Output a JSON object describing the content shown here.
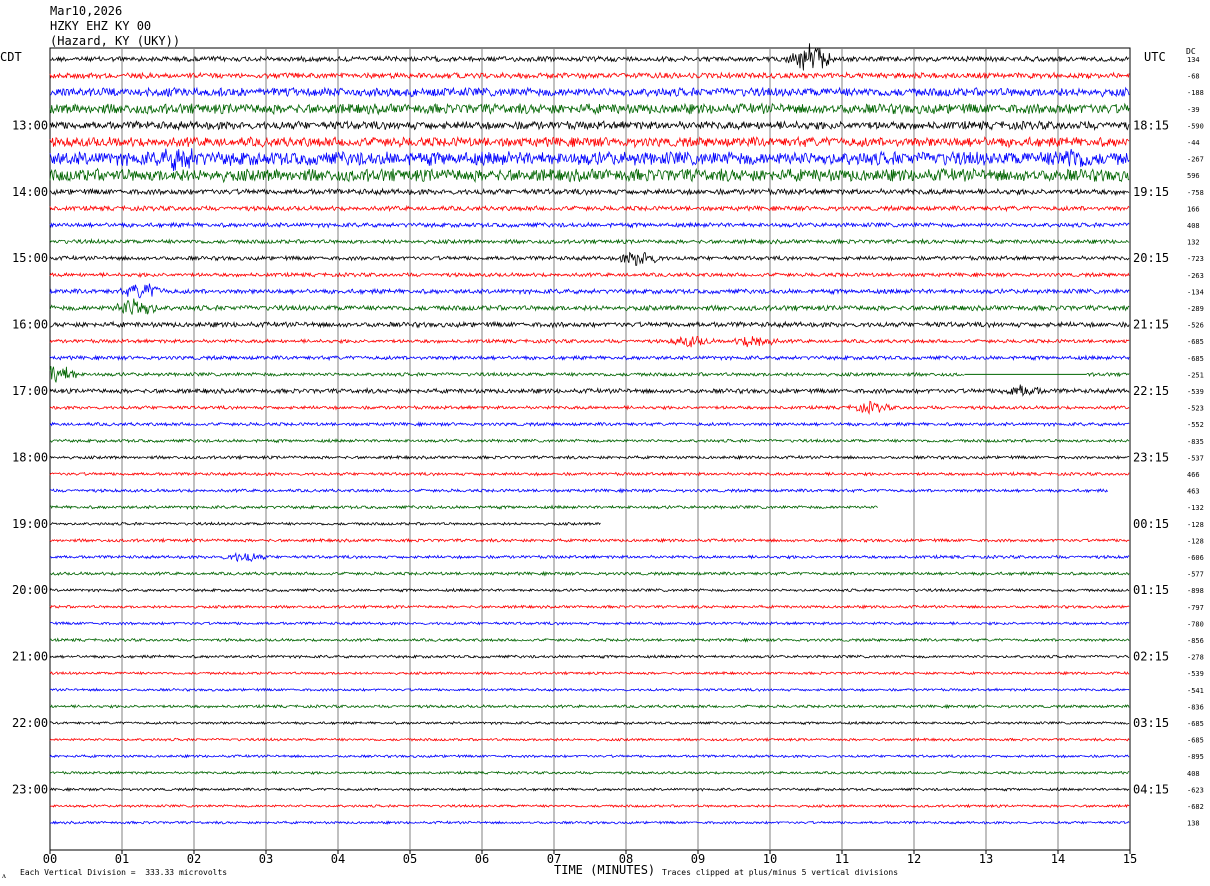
{
  "header": {
    "date": "Mar10,2026",
    "station": "HZKY EHZ KY 00",
    "location": "(Hazard, KY (UKY))"
  },
  "left_timezone": "CDT",
  "right_timezone": "UTC",
  "dc_label": "DC",
  "footer": {
    "scale_note": "Each Vertical Division =  333.33 microvolts",
    "x_axis_title": "TIME (MINUTES)",
    "clip_note": "Traces clipped at plus/minus 5 vertical divisions",
    "corner_mark": "ᴧ"
  },
  "colors": {
    "trace_cycle": [
      "#000000",
      "#ff0000",
      "#0000ff",
      "#006400"
    ],
    "grid": "#808080"
  },
  "chart_data": {
    "type": "helicorder",
    "xlabel": "TIME (MINUTES)",
    "xlim": [
      0,
      15
    ],
    "x_ticks": [
      "00",
      "01",
      "02",
      "03",
      "04",
      "05",
      "06",
      "07",
      "08",
      "09",
      "10",
      "11",
      "12",
      "13",
      "14",
      "15"
    ],
    "traces_per_hour": 4,
    "left_hour_labels": [
      "13:00",
      "14:00",
      "15:00",
      "16:00",
      "17:00",
      "18:00",
      "19:00",
      "20:00",
      "21:00",
      "22:00",
      "23:00"
    ],
    "right_hour_labels": [
      "18:15",
      "19:15",
      "20:15",
      "21:15",
      "22:15",
      "23:15",
      "00:15",
      "01:15",
      "02:15",
      "03:15",
      "04:15"
    ],
    "trace_dc_offsets": [
      "134",
      "-68",
      "-188",
      "-39",
      "-590",
      "-44",
      "-267",
      "596",
      "-758",
      "166",
      "408",
      "132",
      "-723",
      "-263",
      "-134",
      "-289",
      "-526",
      "-685",
      "-685",
      "-251",
      "-539",
      "-523",
      "-552",
      "-835",
      "-537",
      "466",
      "463",
      "-132",
      "-128",
      "-128",
      "-606",
      "-577",
      "-898",
      "-797",
      "-780",
      "-856",
      "-278",
      "-539",
      "-541",
      "-836",
      "-685",
      "-685",
      "-895",
      "408",
      "-623",
      "-682",
      "138"
    ],
    "trace_amplitude_rel": [
      1.0,
      1.1,
      1.7,
      2.0,
      1.6,
      1.9,
      2.7,
      2.5,
      1.1,
      0.9,
      0.85,
      0.8,
      0.8,
      0.75,
      0.9,
      1.0,
      1.0,
      0.7,
      0.75,
      0.7,
      0.9,
      0.65,
      0.65,
      0.6,
      0.6,
      0.6,
      0.6,
      0.6,
      0.55,
      0.6,
      0.6,
      0.6,
      0.55,
      0.55,
      0.55,
      0.55,
      0.55,
      0.5,
      0.5,
      0.55,
      0.5,
      0.5,
      0.5,
      0.5,
      0.5,
      0.5,
      0.5
    ],
    "trace_end_minute": [
      15,
      15,
      15,
      15,
      15,
      15,
      15,
      15,
      15,
      15,
      15,
      15,
      15,
      15,
      15,
      15,
      15,
      15,
      15,
      15,
      15,
      15,
      15,
      15,
      15,
      15,
      14.7,
      11.5,
      7.65,
      15,
      15,
      15,
      15,
      15,
      15,
      15,
      15,
      15,
      15,
      15,
      15,
      15,
      15,
      15,
      15,
      15,
      15
    ],
    "data_gaps": [
      {
        "trace": 19,
        "from_minute": 12.7,
        "to_minute": 14.4
      },
      {
        "trace": 28,
        "from_minute": 7.65,
        "to_minute": 10.0
      },
      {
        "trace": 28,
        "from_minute": 10.7,
        "to_minute": 15
      }
    ],
    "events": [
      {
        "trace": 0,
        "minute": 10.55,
        "amplitude_rel": 6
      },
      {
        "trace": 6,
        "minute": 1.8,
        "amplitude_rel": 3
      },
      {
        "trace": 6,
        "minute": 14.2,
        "amplitude_rel": 2.5
      },
      {
        "trace": 12,
        "minute": 8.2,
        "amplitude_rel": 3
      },
      {
        "trace": 15,
        "minute": 1.2,
        "amplitude_rel": 4
      },
      {
        "trace": 14,
        "minute": 1.3,
        "amplitude_rel": 3
      },
      {
        "trace": 17,
        "minute": 9.8,
        "amplitude_rel": 2.5
      },
      {
        "trace": 17,
        "minute": 8.9,
        "amplitude_rel": 2
      },
      {
        "trace": 19,
        "minute": 0.1,
        "amplitude_rel": 4
      },
      {
        "trace": 20,
        "minute": 13.5,
        "amplitude_rel": 2
      },
      {
        "trace": 21,
        "minute": 11.4,
        "amplitude_rel": 1.8
      },
      {
        "trace": 30,
        "minute": 2.7,
        "amplitude_rel": 1.8
      }
    ]
  }
}
